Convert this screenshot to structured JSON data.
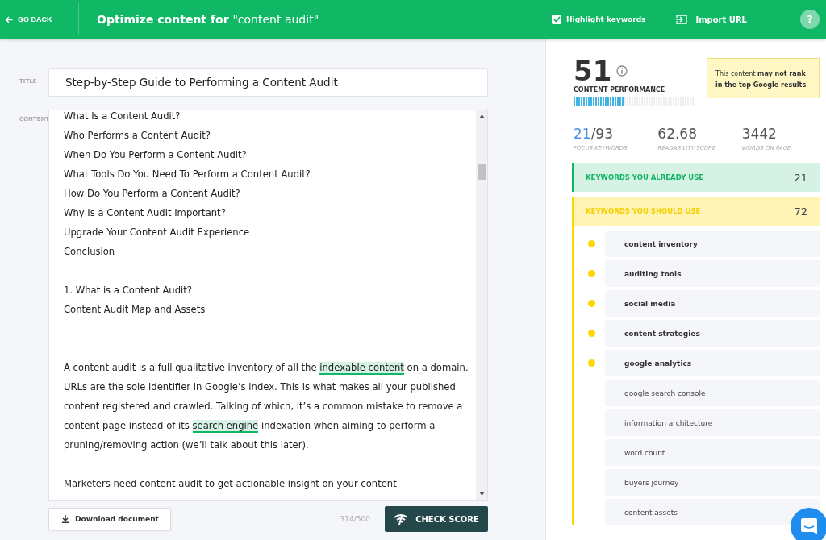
{
  "header": {
    "back": "GO BACK",
    "title_prefix": "Optimize content for",
    "query": "\"content audit\"",
    "highlight_keywords": {
      "label": "Highlight keywords",
      "checked": true
    },
    "import": "Import URL",
    "help": "?"
  },
  "editor": {
    "title_label": "TITLE",
    "title": "Step-by-Step Guide to Performing a Content Audit",
    "content_label": "CONTENT",
    "blocks": [
      {
        "kind": "line",
        "segments": [
          {
            "text": "What Is a Content Audit?",
            "highlight": false
          }
        ]
      },
      {
        "kind": "line",
        "segments": [
          {
            "text": "Who Performs a Content Audit?",
            "highlight": false
          }
        ]
      },
      {
        "kind": "line",
        "segments": [
          {
            "text": "When Do You Perform a Content Audit?",
            "highlight": false
          }
        ]
      },
      {
        "kind": "line",
        "segments": [
          {
            "text": "What Tools Do You Need To Perform a Content Audit?",
            "highlight": false
          }
        ]
      },
      {
        "kind": "line",
        "segments": [
          {
            "text": "How Do You Perform a Content Audit?",
            "highlight": false
          }
        ]
      },
      {
        "kind": "line",
        "segments": [
          {
            "text": "Why Is a Content Audit Important?",
            "highlight": false
          }
        ]
      },
      {
        "kind": "line",
        "segments": [
          {
            "text": "Upgrade Your Content Audit Experience",
            "highlight": false
          }
        ]
      },
      {
        "kind": "line",
        "segments": [
          {
            "text": "Conclusion",
            "highlight": false
          }
        ]
      },
      {
        "kind": "blank"
      },
      {
        "kind": "line",
        "segments": [
          {
            "text": "1. What is a Content Audit?",
            "highlight": false
          }
        ]
      },
      {
        "kind": "line",
        "segments": [
          {
            "text": "Content Audit Map and Assets",
            "highlight": false
          }
        ]
      },
      {
        "kind": "blank"
      },
      {
        "kind": "blank"
      },
      {
        "kind": "line",
        "segments": [
          {
            "text": "A content audit is a full qualitative inventory of all the ",
            "highlight": false
          },
          {
            "text": "indexable content",
            "highlight": true
          },
          {
            "text": " on a domain. URLs are the sole identifier in Google’s index. This is what makes all your published content registered and crawled. Talking of which, it’s a common mistake to remove a content page instead of its ",
            "highlight": false
          },
          {
            "text": "search engine",
            "highlight": true
          },
          {
            "text": " indexation when aiming to perform a pruning/removing action (we’ll talk about this later).",
            "highlight": false
          }
        ]
      },
      {
        "kind": "blank"
      },
      {
        "kind": "line",
        "segments": [
          {
            "text": "Marketers need content audit to get actionable insight on your content",
            "highlight": false
          }
        ]
      }
    ],
    "download": "Download document",
    "counter": "374/500",
    "check": "CHECK SCORE"
  },
  "score": {
    "value": "51",
    "label": "CONTENT PERFORMANCE",
    "level": 0.42,
    "tooltip": "This content **may not rank in the top Google results**",
    "stats": [
      {
        "value": "21",
        "total": "/93",
        "label": "FOCUS KEYWORDS"
      },
      {
        "value": "62.68",
        "label": "READABILITY SCORE"
      },
      {
        "value": "3442",
        "label": "WORDS ON PAGE"
      }
    ]
  },
  "keyword_groups": [
    {
      "kind": "used",
      "title": "KEYWORDS YOU ALREADY USE",
      "count": "21"
    },
    {
      "kind": "should",
      "title": "KEYWORDS YOU SHOULD USE",
      "count": "72",
      "items": [
        {
          "text": "content inventory",
          "important": true
        },
        {
          "text": "auditing tools",
          "important": true
        },
        {
          "text": "social media",
          "important": true
        },
        {
          "text": "content strategies",
          "important": true
        },
        {
          "text": "google analytics",
          "important": true
        },
        {
          "text": "google search console",
          "important": false
        },
        {
          "text": "information architecture",
          "important": false
        },
        {
          "text": "word count",
          "important": false
        },
        {
          "text": "buyers journey",
          "important": false
        },
        {
          "text": "content assets",
          "important": false
        }
      ]
    }
  ]
}
